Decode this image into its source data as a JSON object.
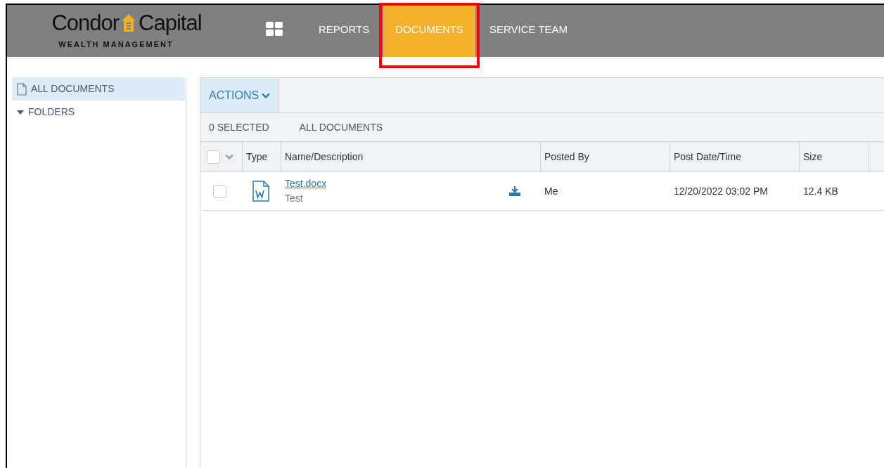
{
  "header": {
    "logo": {
      "word_1": "Condor",
      "word_2": "Capital",
      "tagline": "WEALTH MANAGEMENT"
    },
    "nav": [
      {
        "label": "REPORTS",
        "selected": false
      },
      {
        "label": "DOCUMENTS",
        "selected": true,
        "highlighted": true
      },
      {
        "label": "SERVICE TEAM",
        "selected": false
      }
    ]
  },
  "sidebar": {
    "items": [
      {
        "kind": "file",
        "label": "ALL DOCUMENTS",
        "selected": true
      },
      {
        "kind": "folder",
        "label": "FOLDERS",
        "selected": false,
        "expanded": true
      }
    ]
  },
  "toolbar": {
    "actions": "ACTIONS"
  },
  "status": {
    "selected_count": "0 SELECTED",
    "filter": "ALL DOCUMENTS"
  },
  "table": {
    "select_all_checked": false,
    "columns": [
      "Type",
      "Name/Description",
      "Posted By",
      "Post Date/Time",
      "Size"
    ],
    "rows": [
      {
        "checked": false,
        "name": "Test.docx",
        "description": "Test",
        "posted_by": "Me",
        "posted_at": "12/20/2022 03:02 PM",
        "size": "12.4 KB"
      }
    ]
  }
}
